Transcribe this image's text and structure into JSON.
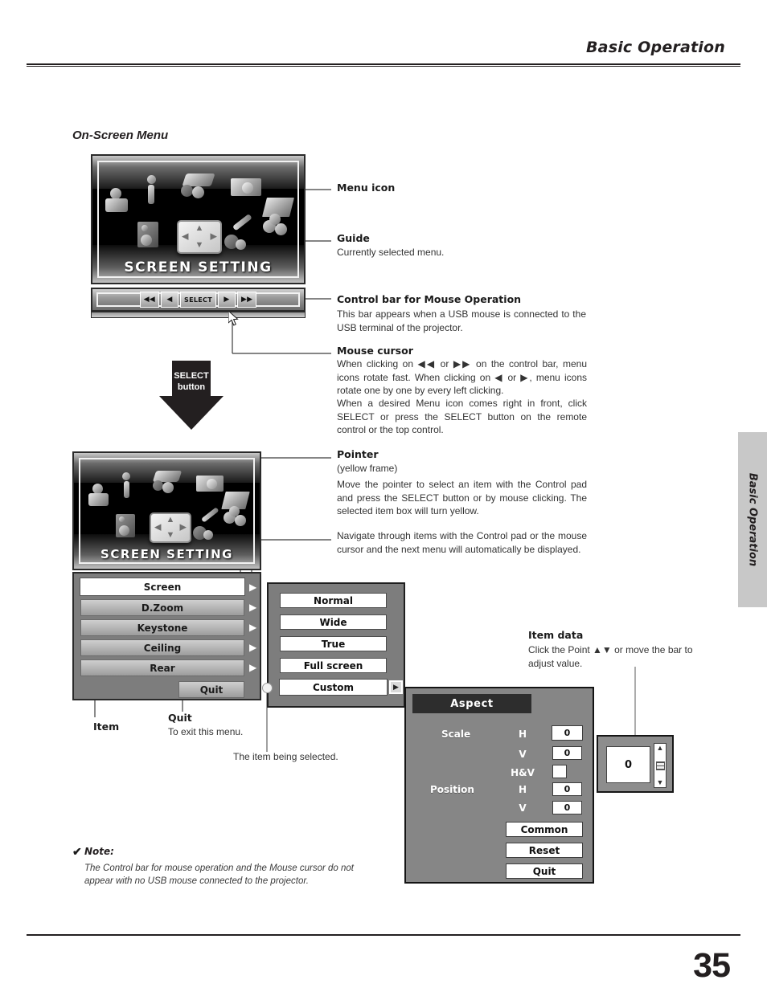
{
  "page": {
    "header_title": "Basic Operation",
    "side_tab_label": "Basic Operation",
    "page_number": "35",
    "section_heading": "On-Screen Menu"
  },
  "osd_top": {
    "guide_text": "SCREEN SETTING",
    "control_bar": {
      "buttons": [
        {
          "name": "fast-rewind",
          "label": "◀◀"
        },
        {
          "name": "prev",
          "label": "◀"
        },
        {
          "name": "select",
          "label": "SELECT"
        },
        {
          "name": "next",
          "label": "▶"
        },
        {
          "name": "fast-forward",
          "label": "▶▶"
        }
      ]
    }
  },
  "select_button_arrow": {
    "line1": "SELECT",
    "line2": "button"
  },
  "osd_bottom": {
    "guide_text": "SCREEN SETTING",
    "menu_items": [
      {
        "label": "Screen",
        "selected": true,
        "arrow": "▶"
      },
      {
        "label": "D.Zoom",
        "selected": false,
        "arrow": "▶"
      },
      {
        "label": "Keystone",
        "selected": false,
        "arrow": "▶"
      },
      {
        "label": "Ceiling",
        "selected": false,
        "arrow": "▶"
      },
      {
        "label": "Rear",
        "selected": false,
        "arrow": "▶"
      }
    ],
    "quit_label": "Quit"
  },
  "submenu": {
    "items": [
      {
        "label": "Normal",
        "selected": false
      },
      {
        "label": "Wide",
        "selected": false
      },
      {
        "label": "True",
        "selected": false
      },
      {
        "label": "Full screen",
        "selected": false
      },
      {
        "label": "Custom",
        "selected": true
      }
    ],
    "next_arrow": "▶"
  },
  "aspect_dialog": {
    "title": "Aspect",
    "rows": [
      {
        "group": "Scale",
        "axis": "H",
        "value": "0",
        "focused": true
      },
      {
        "group": "",
        "axis": "V",
        "value": "0",
        "focused": false
      },
      {
        "group": "",
        "axis": "H&V",
        "value": "",
        "focused": false
      },
      {
        "group": "Position",
        "axis": "H",
        "value": "0",
        "focused": false
      },
      {
        "group": "",
        "axis": "V",
        "value": "0",
        "focused": false
      }
    ],
    "scale_label": "Scale",
    "position_label": "Position",
    "axis_h1": "H",
    "axis_v1": "V",
    "axis_hv": "H&V",
    "axis_h2": "H",
    "axis_v2": "V",
    "value_scale_h": "0",
    "value_scale_v": "0",
    "value_position_h": "0",
    "value_position_v": "0",
    "buttons": [
      {
        "label": "Common"
      },
      {
        "label": "Reset"
      },
      {
        "label": "Quit"
      }
    ],
    "common_label": "Common",
    "reset_label": "Reset",
    "quit_label": "Quit"
  },
  "item_data_box": {
    "value": "0",
    "scroll_up": "▲",
    "scroll_down": "▼"
  },
  "annotations": {
    "menu_icon": {
      "title": "Menu icon"
    },
    "guide": {
      "title": "Guide",
      "body": "Currently selected menu."
    },
    "control_bar": {
      "title": "Control bar for Mouse Operation",
      "body": "This bar appears when a USB mouse is connected to the USB terminal of the projector."
    },
    "mouse_cursor": {
      "title": "Mouse cursor",
      "body1": "When clicking on ◀◀ or ▶▶ on the control bar, menu icons rotate fast.  When clicking on ◀ or ▶, menu icons rotate one by one by every left clicking.",
      "body2": "When a desired Menu icon comes right in front, click SELECT or press the SELECT button on the remote control or the top control."
    },
    "pointer": {
      "title": "Pointer",
      "sub": "(yellow frame)",
      "body": "Move the pointer to select an item with the Control pad and press the SELECT button or by mouse clicking.  The selected item box will turn yellow."
    },
    "navigate": {
      "body": "Navigate through items with the Control pad or the mouse cursor and the next menu will automatically be displayed."
    },
    "item_data": {
      "title": "Item data",
      "body": "Click the Point ▲▼ or move the bar to adjust value."
    },
    "item": {
      "title": "Item"
    },
    "quit": {
      "title": "Quit",
      "body": "To exit this menu."
    },
    "item_selected": {
      "body": "The item being selected."
    }
  },
  "note": {
    "check": "✔",
    "label": "Note:",
    "body": "The Control bar for mouse operation and the Mouse cursor do not appear with no USB mouse connected to the projector."
  }
}
